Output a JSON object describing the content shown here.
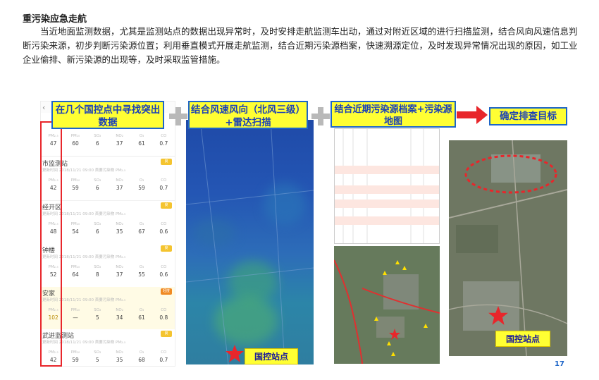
{
  "heading": "重污染应急走航",
  "paragraph": "当近地面监测数据，尤其是监测站点的数据出现异常时，及时安排走航监测车出动，通过对附近区域的进行扫描监测，结合风向风速信息判断污染来源，初步判断污染源位置；利用垂直模式开展走航监测，结合近期污染源档案，快速溯源定位，及时发现异常情况出现的原因，如工业企业偷排、新污染源的出现等，及时采取监管措施。",
  "callouts": {
    "step1": "在几个国控点中寻找突出数据",
    "step2": "结合风速风向（北风三级）+雷达扫描",
    "step3": "结合近期污染源档案+污染源地图",
    "step4": "确定排查目标"
  },
  "station_label": "国控站点",
  "metric_labels": [
    "PM₂.₅",
    "PM₁₀",
    "SO₂",
    "NO₂",
    "O₃",
    "CO"
  ],
  "stations": [
    {
      "name": "",
      "sub": "",
      "badge": "",
      "values": [
        "47",
        "60",
        "6",
        "37",
        "61",
        "0.7"
      ],
      "highlight": false
    },
    {
      "name": "市监测站",
      "sub": "更新时间 2018/11/21 09:00 首要污染物 PM₂.₅",
      "badge": "良",
      "values": [
        "42",
        "59",
        "6",
        "37",
        "59",
        "0.7"
      ],
      "highlight": false
    },
    {
      "name": "经开区",
      "sub": "更新时间 2018/11/21 09:00 首要污染物 PM₂.₅",
      "badge": "良",
      "values": [
        "48",
        "54",
        "6",
        "35",
        "67",
        "0.6"
      ],
      "highlight": false
    },
    {
      "name": "钟楼",
      "sub": "更新时间 2018/11/21 09:00 首要污染物 PM₂.₅",
      "badge": "良",
      "values": [
        "52",
        "64",
        "8",
        "37",
        "55",
        "0.6"
      ],
      "highlight": false
    },
    {
      "name": "安家",
      "sub": "更新时间 2018/11/21 09:00 首要污染物 PM₂.₅",
      "badge": "轻度",
      "values": [
        "102",
        "—",
        "5",
        "34",
        "61",
        "0.8"
      ],
      "highlight": true
    },
    {
      "name": "武进监测站",
      "sub": "更新时间 2018/11/21 09:00 首要污染物 PM₂.₅",
      "badge": "良",
      "values": [
        "42",
        "59",
        "5",
        "35",
        "68",
        "0.7"
      ],
      "highlight": false
    }
  ],
  "page_number": "17",
  "colors": {
    "callout_bg": "#ffff33",
    "callout_border": "#1e66c8",
    "red": "#e8262b",
    "arrow": "#e8262b"
  }
}
